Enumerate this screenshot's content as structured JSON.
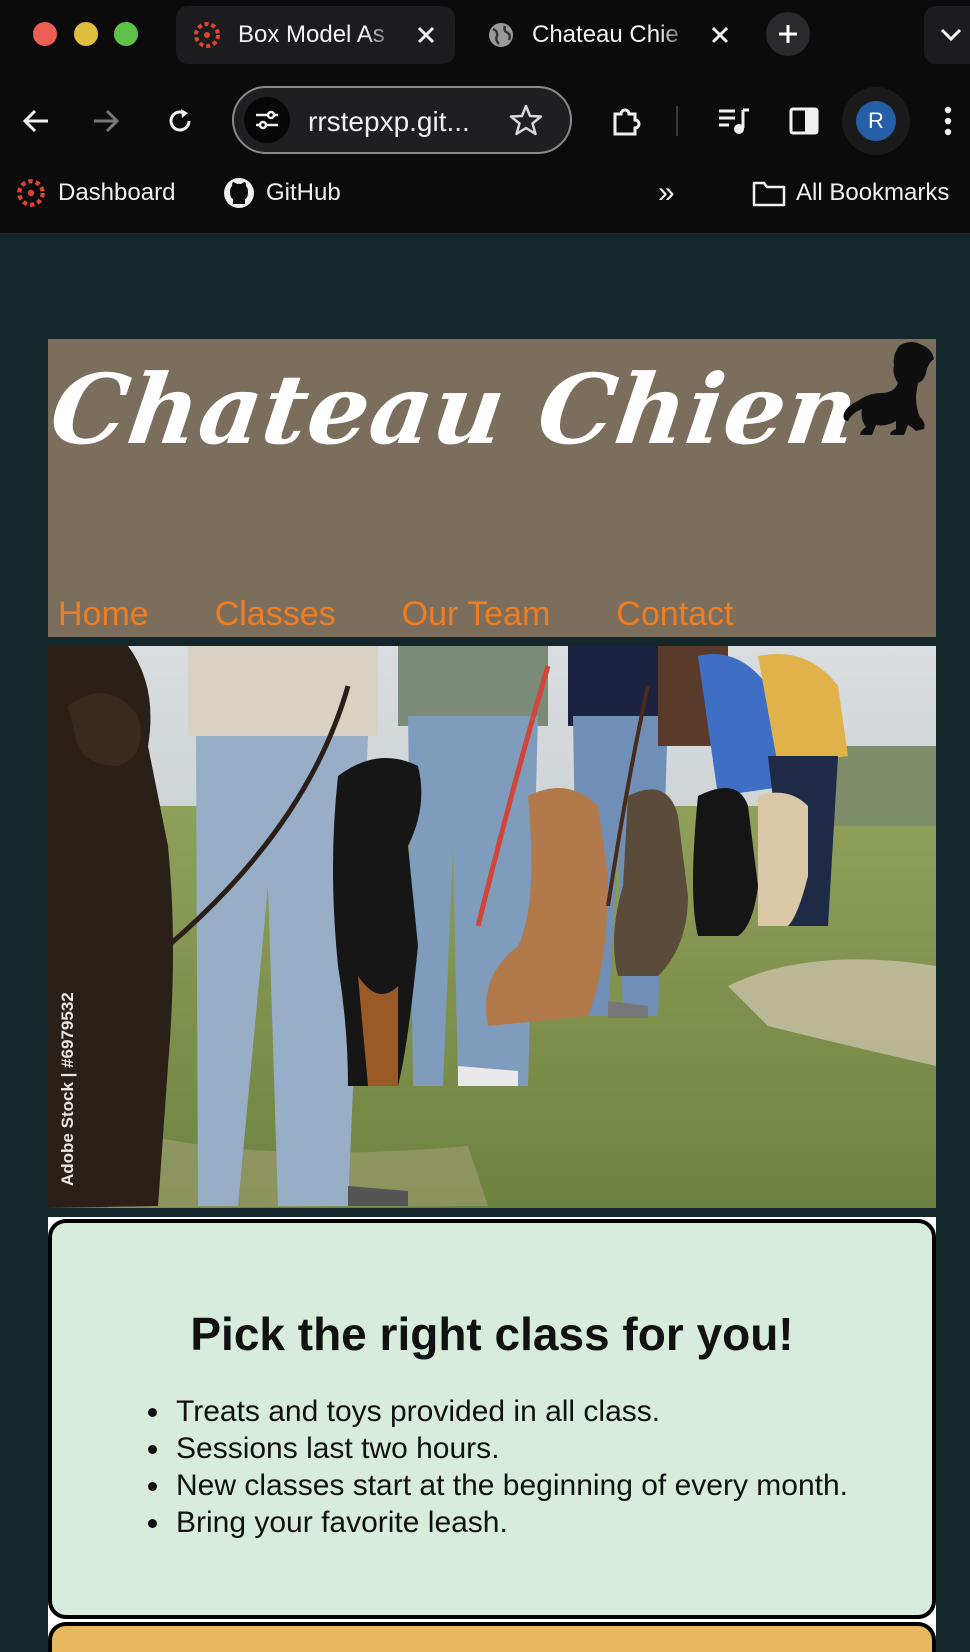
{
  "browser": {
    "tabs": [
      {
        "title": "Box Model As",
        "active": false
      },
      {
        "title": "Chateau Chie",
        "active": true
      }
    ],
    "url": "rrstepxp.git...",
    "avatar_initial": "R",
    "bookmarks": [
      {
        "label": "Dashboard",
        "icon": "canvas-icon"
      },
      {
        "label": "GitHub",
        "icon": "github-icon"
      }
    ],
    "bookmarks_overflow": "»",
    "all_bookmarks": "All Bookmarks"
  },
  "site": {
    "logo": "Chateau Chien",
    "nav": [
      "Home",
      "Classes",
      "Our Team",
      "Contact"
    ],
    "hero_watermark": "Adobe Stock | #6979532"
  },
  "classes": {
    "heading": "Pick the right class for you!",
    "items": [
      "Treats and toys provided in all class.",
      "Sessions last two hours.",
      "New classes start at the beginning of every month.",
      "Bring your favorite leash."
    ]
  },
  "colors": {
    "page_bg": "#13262a",
    "header_bg": "#7c6e5c",
    "nav_link": "#f07d1f",
    "card_bg": "#d7ecdd",
    "card2_bg": "#e8b85e"
  }
}
